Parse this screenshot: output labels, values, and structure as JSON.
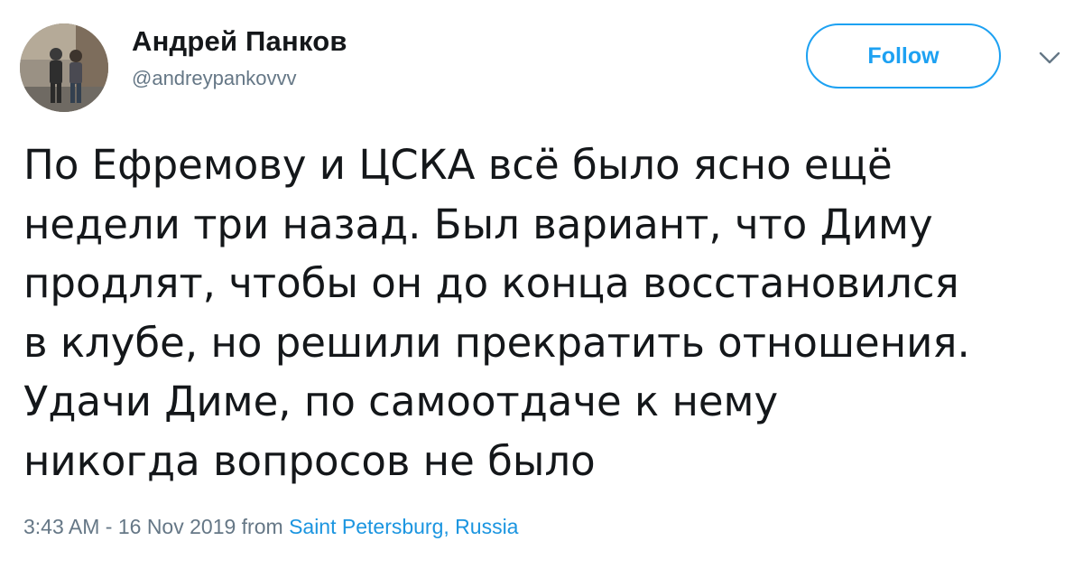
{
  "author": {
    "display_name": "Андрей Панков",
    "handle": "@andreypankovvv"
  },
  "follow_button": {
    "label": "Follow"
  },
  "menu": {
    "icon": "chevron-down-icon"
  },
  "tweet": {
    "lines": [
      "По Ефремову и ЦСКА всё было ясно ещё",
      "недели три назад. Был вариант, что Диму",
      "продлят, чтобы он до конца восстановился",
      "в клубе, но решили прекратить отношения.",
      "Удачи Диме, по самоотдаче к нему",
      "никогда вопросов не было"
    ]
  },
  "meta": {
    "time": "3:43 AM",
    "separator": "-",
    "date": "16 Nov 2019",
    "from_label": "from",
    "location": "Saint Petersburg, Russia"
  },
  "colors": {
    "accent": "#1da1f2",
    "link": "#1b95e0",
    "text": "#14171a",
    "secondary": "#657786"
  }
}
